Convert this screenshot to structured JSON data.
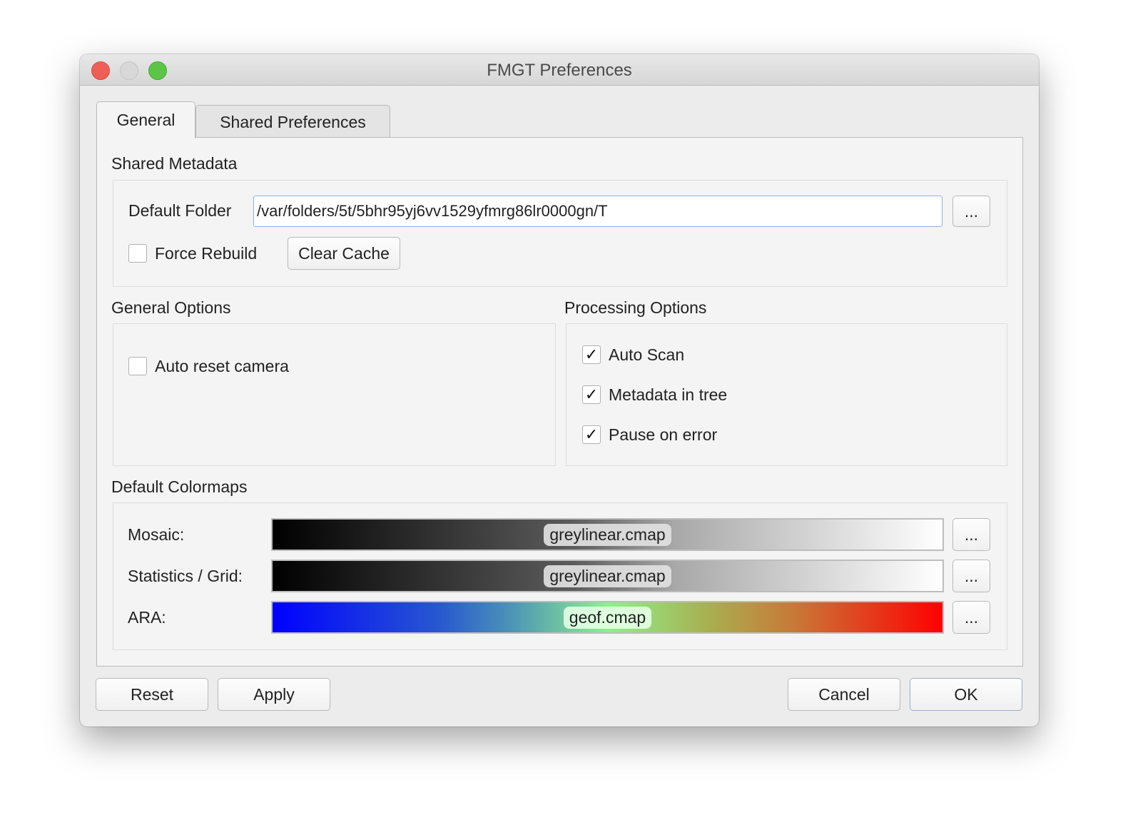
{
  "window": {
    "title": "FMGT Preferences"
  },
  "tabs": [
    {
      "label": "General",
      "active": true
    },
    {
      "label": "Shared Preferences",
      "active": false
    }
  ],
  "shared_metadata": {
    "heading": "Shared Metadata",
    "default_folder_label": "Default Folder",
    "default_folder_value": "/var/folders/5t/5bhr95yj6vv1529yfmrg86lr0000gn/T",
    "browse_label": "...",
    "force_rebuild_label": "Force Rebuild",
    "force_rebuild_checked": false,
    "clear_cache_label": "Clear Cache"
  },
  "general_options": {
    "heading": "General Options",
    "auto_reset_camera_label": "Auto reset camera",
    "auto_reset_camera_checked": false
  },
  "processing_options": {
    "heading": "Processing Options",
    "items": [
      {
        "label": "Auto Scan",
        "checked": true,
        "mark": "✓"
      },
      {
        "label": "Metadata in tree",
        "checked": true,
        "mark": "✓"
      },
      {
        "label": "Pause on error",
        "checked": true,
        "mark": "✓"
      }
    ]
  },
  "colormaps": {
    "heading": "Default Colormaps",
    "rows": [
      {
        "label": "Mosaic:",
        "value": "greylinear.cmap",
        "browse": "..."
      },
      {
        "label": "Statistics / Grid:",
        "value": "greylinear.cmap",
        "browse": "..."
      },
      {
        "label": "ARA:",
        "value": "geof.cmap",
        "browse": "..."
      }
    ]
  },
  "buttons": {
    "reset": "Reset",
    "apply": "Apply",
    "cancel": "Cancel",
    "ok": "OK"
  },
  "colors": {
    "close": "#ee5f57",
    "minimize": "#d8d8d8",
    "zoom": "#5cc548"
  }
}
